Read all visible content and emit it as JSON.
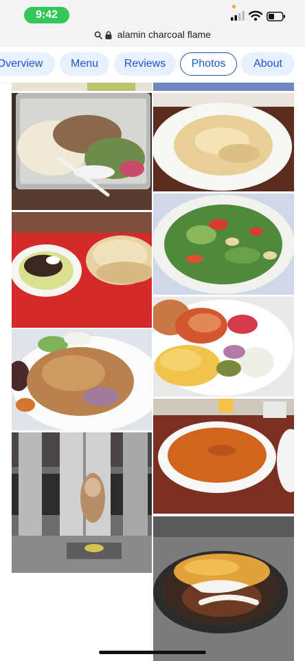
{
  "status_bar": {
    "time": "9:42",
    "icons": [
      "cellular-signal-icon",
      "wifi-icon",
      "battery-icon"
    ],
    "time_pill_color": "#34c759"
  },
  "browser": {
    "url": "alamin charcoal flame",
    "icons": [
      "search-icon",
      "lock-icon"
    ]
  },
  "tabs": [
    {
      "label": "Overview",
      "active": false
    },
    {
      "label": "Menu",
      "active": false
    },
    {
      "label": "Reviews",
      "active": false
    },
    {
      "label": "Photos",
      "active": true
    },
    {
      "label": "About",
      "active": false
    }
  ],
  "accent_color": "#1a57c6",
  "photos": [
    {
      "label": "shawarma-rice-tray-photo"
    },
    {
      "label": "pasta-plate-photo"
    },
    {
      "label": "shawarma-pita-platter-photo"
    },
    {
      "label": "fattoush-salad-photo"
    },
    {
      "label": "chicken-shawarma-plate-photo"
    },
    {
      "label": "salmon-fries-plate-photo"
    },
    {
      "label": "shawarma-spit-photo"
    },
    {
      "label": "lentil-soup-photo"
    },
    {
      "label": "steak-fries-plate-photo"
    }
  ]
}
